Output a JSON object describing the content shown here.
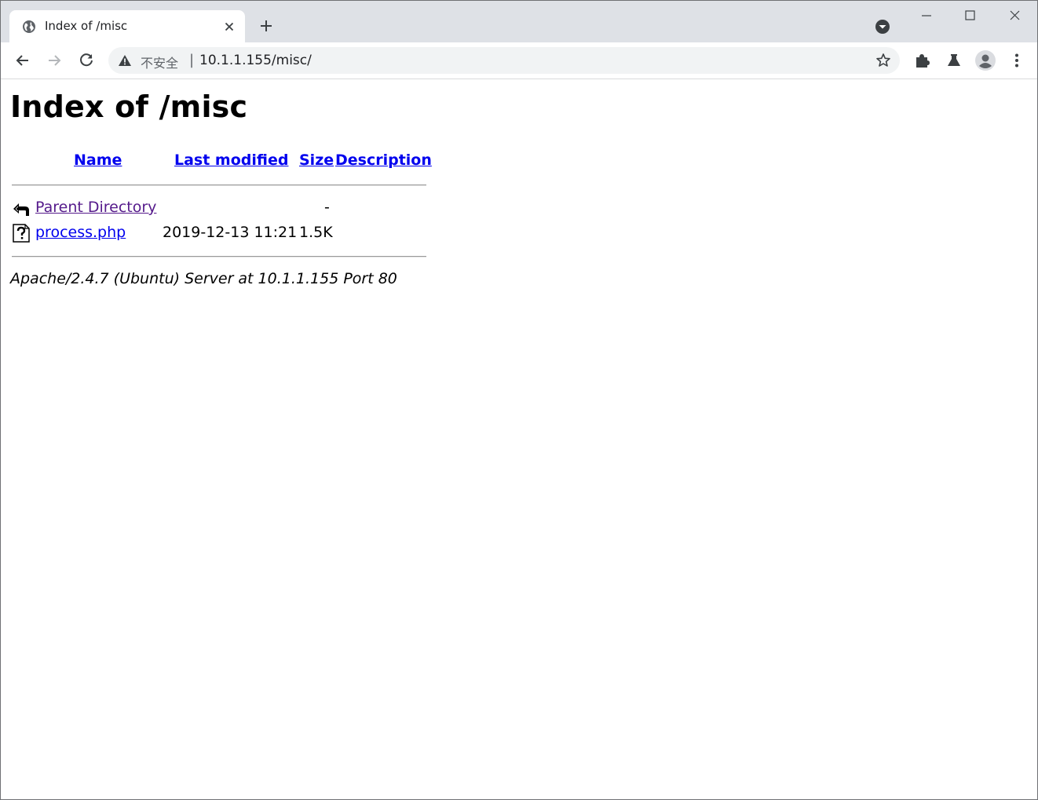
{
  "browser": {
    "tab_title": "Index of /misc",
    "omnibox": {
      "security_label": "不安全",
      "separator": "|",
      "url": "10.1.1.155/misc/"
    },
    "icons": [
      "globe-icon",
      "close-icon",
      "plus-icon",
      "tab-search-icon",
      "minimize-icon",
      "maximize-icon",
      "close-window-icon",
      "back-icon",
      "forward-icon",
      "reload-icon",
      "warning-icon",
      "star-icon",
      "extensions-icon",
      "labs-flask-icon",
      "profile-avatar-icon",
      "more-menu-icon"
    ]
  },
  "page": {
    "heading": "Index of /misc",
    "columns": {
      "name": "Name",
      "last_modified": "Last modified",
      "size": "Size",
      "description": "Description"
    },
    "rows": [
      {
        "icon": "back-folder-icon",
        "name": "Parent Directory",
        "last_modified": "",
        "size": "-",
        "description": ""
      },
      {
        "icon": "unknown-file-icon",
        "name": "process.php",
        "last_modified": "2019-12-13 11:21",
        "size": "1.5K",
        "description": ""
      }
    ],
    "footer": "Apache/2.4.7 (Ubuntu) Server at 10.1.1.155 Port 80"
  },
  "colors": {
    "link": "#0000ee",
    "visited_link": "#551a8b",
    "tabstrip": "#dee1e6",
    "omnibox": "#f1f3f4"
  }
}
